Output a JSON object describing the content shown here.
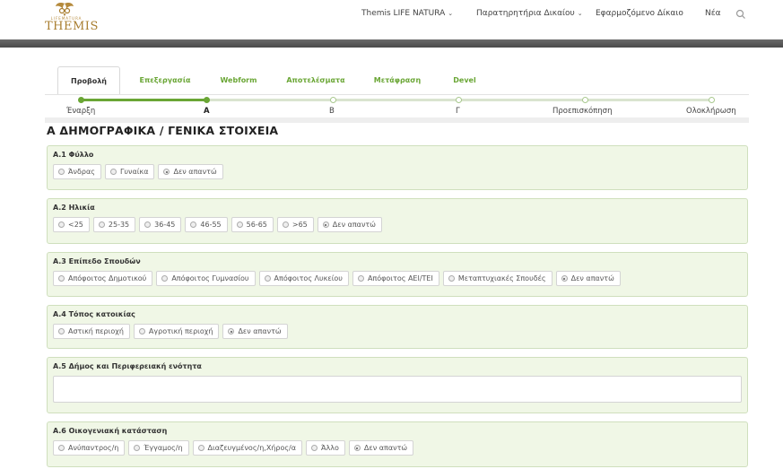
{
  "header": {
    "logo": {
      "sub": "LIFEMATURA",
      "name": "THEMIS"
    },
    "nav": [
      {
        "label": "Themis LIFE NATURA",
        "dropdown": true
      },
      {
        "label": "Παρατηρητήρια Δικαίου",
        "dropdown": true
      },
      {
        "label": "Εφαρμοζόμενο Δίκαιο",
        "dropdown": false
      },
      {
        "label": "Νέα",
        "dropdown": false
      }
    ],
    "search_icon": "search-icon"
  },
  "tabs": [
    "Προβολή",
    "Επεξεργασία",
    "Webform",
    "Αποτελέσματα",
    "Μετάφραση",
    "Devel"
  ],
  "active_tab": 0,
  "progress": {
    "steps": [
      "Έναρξη",
      "Α",
      "Β",
      "Γ",
      "Προεπισκόπηση",
      "Ολοκλήρωση"
    ],
    "current": 1
  },
  "section_title": "Α ΔΗΜΟΓΡΑΦΙΚΑ / ΓΕΝΙΚΑ ΣΤΟΙΧΕΙΑ",
  "questions": [
    {
      "label": "Α.1 Φύλλο",
      "type": "radio",
      "options": [
        "Άνδρας",
        "Γυναίκα",
        "Δεν απαντώ"
      ],
      "selected": 2
    },
    {
      "label": "Α.2 Ηλικία",
      "type": "radio",
      "options": [
        "<25",
        "25-35",
        "36-45",
        "46-55",
        "56-65",
        ">65",
        "Δεν απαντώ"
      ],
      "selected": 6
    },
    {
      "label": "Α.3 Επίπεδο Σπουδών",
      "type": "radio",
      "options": [
        "Απόφοιτος Δημοτικού",
        "Απόφοιτος Γυμνασίου",
        "Απόφοιτος Λυκείου",
        "Απόφοιτος ΑΕΙ/ΤΕΙ",
        "Μεταπτυχιακές Σπουδές",
        "Δεν απαντώ"
      ],
      "selected": 5
    },
    {
      "label": "Α.4 Τόπος κατοικίας",
      "type": "radio",
      "options": [
        "Αστική περιοχή",
        "Αγροτική περιοχή",
        "Δεν απαντώ"
      ],
      "selected": 2
    },
    {
      "label": "Α.5 Δήμος και Περιφερειακή ενότητα",
      "type": "text",
      "value": ""
    },
    {
      "label": "Α.6 Οικογενιακή κατάσταση",
      "type": "radio",
      "options": [
        "Ανύπαντρος/η",
        "Έγγαμος/η",
        "Διαζευγμένος/η,Χήρος/α",
        "Άλλο",
        "Δεν απαντώ"
      ],
      "selected": 4
    }
  ]
}
